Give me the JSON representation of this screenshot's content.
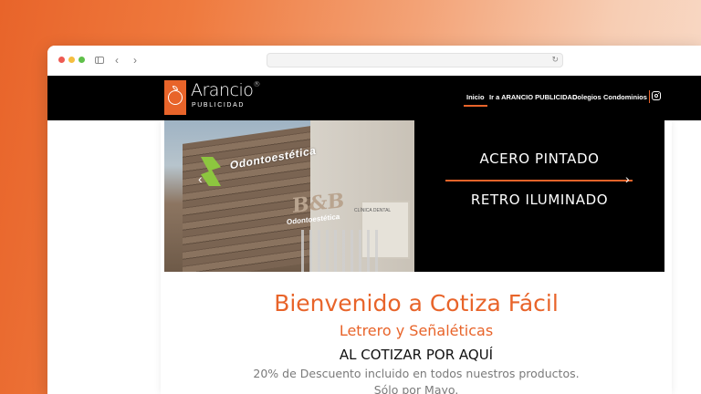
{
  "browser": {
    "back_icon": "‹",
    "forward_icon": "›",
    "reload_icon": "↻"
  },
  "brand": {
    "name": "Arancio",
    "registered": "®",
    "subtitle": "PUBLICIDAD",
    "color": "#e8642a"
  },
  "nav": {
    "items": [
      {
        "label": "Inicio",
        "active": true
      },
      {
        "label": "Ir a ARANCIO PUBLICIDAD"
      },
      {
        "label": "Colegios"
      },
      {
        "label": "Condominios"
      }
    ],
    "social_icon": "instagram-icon"
  },
  "slider": {
    "photo_top_text": "Odontoestética",
    "photo_sign": "B&B",
    "photo_sign_sub": "Odontoestética",
    "door_text": "CLÍNICA DENTAL",
    "line1": "ACERO PINTADO",
    "line2": "RETRO ILUMINADO",
    "prev_icon": "‹",
    "next_icon": "›"
  },
  "content": {
    "welcome": "Bienvenido a Cotiza Fácil",
    "subtitle": "Letrero y Señaléticas",
    "cta": "AL COTIZAR POR AQUÍ",
    "discount": "20% de Descuento incluido en todos nuestros productos.",
    "only_may": "Sólo por Mayo."
  }
}
